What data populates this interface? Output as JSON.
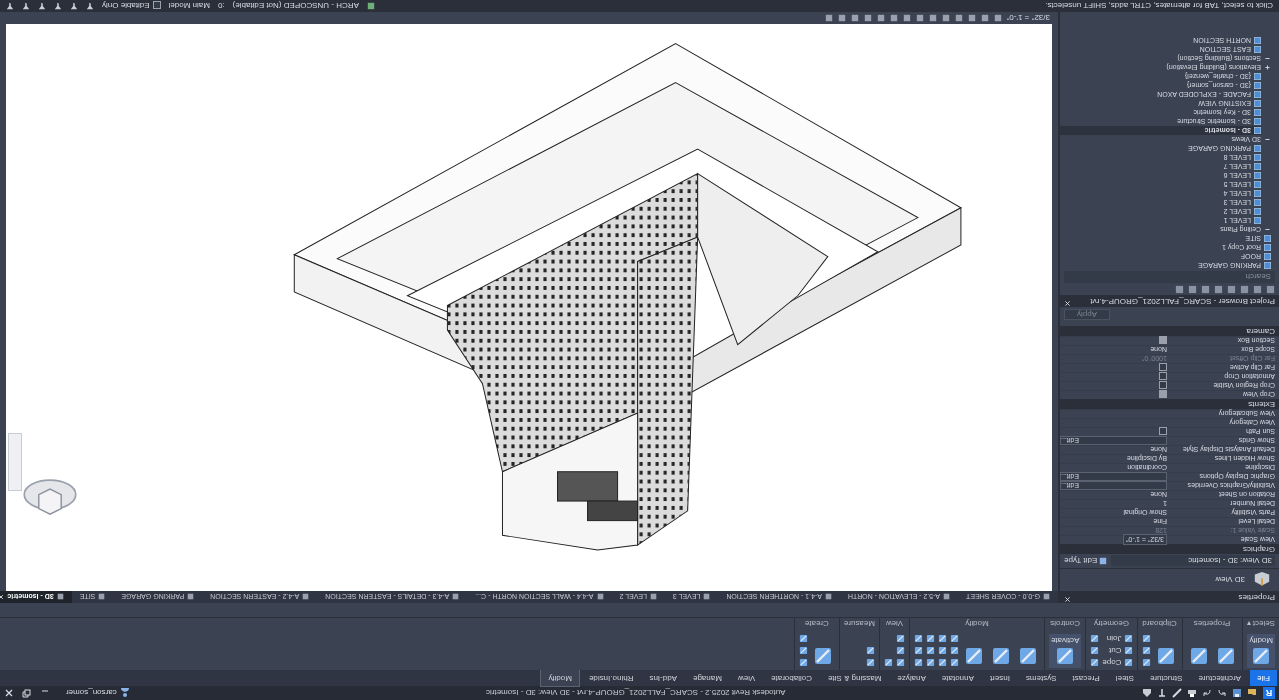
{
  "title_bar": {
    "logo": "R",
    "title": "Autodesk Revit 2025.2 - SCARC_FALL2021_GROUP-4.rvt - 3D View: 3D - Isometric",
    "user": "carson_somer"
  },
  "ribbon": {
    "tabs": [
      {
        "label": "File",
        "selected": false
      },
      {
        "label": "Architecture",
        "selected": false
      },
      {
        "label": "Structure",
        "selected": false
      },
      {
        "label": "Steel",
        "selected": false
      },
      {
        "label": "Precast",
        "selected": false
      },
      {
        "label": "Systems",
        "selected": false
      },
      {
        "label": "Insert",
        "selected": false
      },
      {
        "label": "Annotate",
        "selected": false
      },
      {
        "label": "Analyze",
        "selected": false
      },
      {
        "label": "Massing & Site",
        "selected": false
      },
      {
        "label": "Collaborate",
        "selected": false
      },
      {
        "label": "View",
        "selected": false
      },
      {
        "label": "Manage",
        "selected": false
      },
      {
        "label": "Add-Ins",
        "selected": false
      },
      {
        "label": "Rhino.Inside",
        "selected": false
      },
      {
        "label": "Modify",
        "selected": true
      }
    ],
    "panels": [
      {
        "label": "Select ▾",
        "tools": [
          {
            "kind": "large",
            "label": "Modify"
          }
        ]
      },
      {
        "label": "Properties",
        "tools": [
          {
            "kind": "large"
          },
          {
            "kind": "large"
          }
        ]
      },
      {
        "label": "Clipboard",
        "tools": [
          {
            "kind": "large"
          },
          {
            "kind": "small"
          },
          {
            "kind": "small"
          },
          {
            "kind": "small"
          }
        ]
      },
      {
        "label": "Geometry",
        "tools": [
          {
            "kind": "small",
            "label": "Cope"
          },
          {
            "kind": "small",
            "label": "Cut"
          },
          {
            "kind": "small",
            "label": "Join"
          },
          {
            "kind": "small"
          },
          {
            "kind": "small"
          },
          {
            "kind": "small"
          }
        ]
      },
      {
        "label": "Controls",
        "tools": [
          {
            "kind": "large",
            "label": "Activate"
          }
        ]
      },
      {
        "label": "Modify",
        "tools": [
          {
            "kind": "large"
          },
          {
            "kind": "large"
          },
          {
            "kind": "large"
          },
          {
            "kind": "small"
          },
          {
            "kind": "small"
          },
          {
            "kind": "small"
          },
          {
            "kind": "small"
          },
          {
            "kind": "small"
          },
          {
            "kind": "small"
          },
          {
            "kind": "small"
          },
          {
            "kind": "small"
          },
          {
            "kind": "small"
          },
          {
            "kind": "small"
          },
          {
            "kind": "small"
          },
          {
            "kind": "small"
          }
        ]
      },
      {
        "label": "View",
        "tools": [
          {
            "kind": "small"
          },
          {
            "kind": "small"
          },
          {
            "kind": "small"
          },
          {
            "kind": "small"
          }
        ]
      },
      {
        "label": "Measure",
        "tools": [
          {
            "kind": "small"
          },
          {
            "kind": "small"
          }
        ]
      },
      {
        "label": "Create",
        "tools": [
          {
            "kind": "large"
          },
          {
            "kind": "small"
          },
          {
            "kind": "small"
          },
          {
            "kind": "small"
          }
        ]
      }
    ]
  },
  "view_tabs": [
    {
      "label": "G-0.0 - COVER SHEET",
      "selected": false
    },
    {
      "label": "A-5.2 - ELEVATION - NORTH",
      "selected": false
    },
    {
      "label": "A-4.1 - NORTHERN SECTION",
      "selected": false
    },
    {
      "label": "LEVEL 3",
      "selected": false
    },
    {
      "label": "LEVEL 2",
      "selected": false
    },
    {
      "label": "A-4.4 - WALL SECTION NORTH - C...",
      "selected": false
    },
    {
      "label": "A-4.3 - DETAILS - EASTERN SECTION",
      "selected": false
    },
    {
      "label": "A-4.2 - EASTERN SECTION",
      "selected": false
    },
    {
      "label": "PARKING GARAGE",
      "selected": false
    },
    {
      "label": "SITE",
      "selected": false
    },
    {
      "label": "3D - Isometric",
      "selected": true
    }
  ],
  "properties": {
    "title": "Properties",
    "type_name": "3D View",
    "instance": "3D View: 3D - Isometric",
    "edit_type": "Edit Type",
    "groups": [
      {
        "label": "Graphics",
        "rows": [
          {
            "kind": "dropdown",
            "label": "View Scale",
            "value": "3/32\" = 1'-0\"",
            "disabled": false
          },
          {
            "kind": "text",
            "label": "Scale Value 1:",
            "value": "128",
            "disabled": true
          },
          {
            "kind": "text",
            "label": "Detail Level",
            "value": "Fine",
            "disabled": false
          },
          {
            "kind": "text",
            "label": "Parts Visibility",
            "value": "Show Original",
            "disabled": false
          },
          {
            "kind": "text",
            "label": "Detail Number",
            "value": "1",
            "disabled": false
          },
          {
            "kind": "text",
            "label": "Rotation on Sheet",
            "value": "None",
            "disabled": false
          },
          {
            "kind": "button",
            "label": "Visibility/Graphics Overrides",
            "value": "Edit...",
            "disabled": false
          },
          {
            "kind": "button",
            "label": "Graphic Display Options",
            "value": "Edit...",
            "disabled": false
          },
          {
            "kind": "text",
            "label": "Discipline",
            "value": "Coordination",
            "disabled": false
          },
          {
            "kind": "text",
            "label": "Show Hidden Lines",
            "value": "By Discipline",
            "disabled": false
          },
          {
            "kind": "text",
            "label": "Default Analysis Display Style",
            "value": "None",
            "disabled": false
          },
          {
            "kind": "button",
            "label": "Show Grids",
            "value": "Edit...",
            "disabled": false
          },
          {
            "kind": "check",
            "label": "Sun Path",
            "checked": false,
            "disabled": false
          },
          {
            "kind": "text",
            "label": "View Category",
            "disabled": false
          },
          {
            "kind": "text",
            "label": "View Subcategory",
            "disabled": false
          }
        ]
      },
      {
        "label": "Extents",
        "rows": [
          {
            "kind": "check",
            "label": "Crop View",
            "checked": true,
            "disabled": false
          },
          {
            "kind": "check",
            "label": "Crop Region Visible",
            "checked": false,
            "disabled": false
          },
          {
            "kind": "check",
            "label": "Annotation Crop",
            "checked": false,
            "disabled": false
          },
          {
            "kind": "check",
            "label": "Far Clip Active",
            "checked": false,
            "disabled": false
          },
          {
            "kind": "text",
            "label": "Far Clip Offset",
            "value": "1000' 0\"",
            "disabled": true
          },
          {
            "kind": "text",
            "label": "Scope Box",
            "value": "None",
            "disabled": false
          },
          {
            "kind": "check",
            "label": "Section Box",
            "checked": true,
            "disabled": false
          }
        ]
      },
      {
        "label": "Camera"
      }
    ],
    "apply": "Apply"
  },
  "project_browser": {
    "title": "Project Browser - SCARC_FALL2021_GROUP-4.rvt",
    "search_placeholder": "Search",
    "tree": [
      {
        "kind": "view",
        "label": "PARKING GARAGE",
        "selected": false
      },
      {
        "kind": "view",
        "label": "ROOF",
        "selected": false
      },
      {
        "kind": "view",
        "label": "Roof Copy 1",
        "selected": false
      },
      {
        "kind": "view",
        "label": "SITE",
        "selected": false
      },
      {
        "kind": "group",
        "label": "Ceiling Plans",
        "expanded": true,
        "children": [
          {
            "kind": "view",
            "label": "LEVEL 1",
            "selected": false
          },
          {
            "kind": "view",
            "label": "LEVEL 2",
            "selected": false
          },
          {
            "kind": "view",
            "label": "LEVEL 3",
            "selected": false
          },
          {
            "kind": "view",
            "label": "LEVEL 4",
            "selected": false
          },
          {
            "kind": "view",
            "label": "LEVEL 5",
            "selected": false
          },
          {
            "kind": "view",
            "label": "LEVEL 6",
            "selected": false
          },
          {
            "kind": "view",
            "label": "LEVEL 7",
            "selected": false
          },
          {
            "kind": "view",
            "label": "LEVEL 8",
            "selected": false
          },
          {
            "kind": "view",
            "label": "PARKING GARAGE",
            "selected": false
          }
        ]
      },
      {
        "kind": "group",
        "label": "3D Views",
        "expanded": true,
        "children": [
          {
            "kind": "view",
            "label": "3D - Isometric",
            "selected": true
          },
          {
            "kind": "view",
            "label": "3D - Isometric Structure",
            "selected": false
          },
          {
            "kind": "view",
            "label": "3D - Key Isometric",
            "selected": false
          },
          {
            "kind": "view",
            "label": "EXISTING VIEW",
            "selected": false
          },
          {
            "kind": "view",
            "label": "FACADE - EXPLODED AXON",
            "selected": false
          },
          {
            "kind": "view",
            "label": "{3D - carson_somer}",
            "selected": false
          },
          {
            "kind": "view",
            "label": "{3D - charlie_wenzel}",
            "selected": false
          }
        ]
      },
      {
        "kind": "group",
        "label": "Elevations (Building Elevation)",
        "expanded": false
      },
      {
        "kind": "group",
        "label": "Sections (Building Section)",
        "expanded": true,
        "children": [
          {
            "kind": "view",
            "label": "EAST SECTION",
            "selected": false
          },
          {
            "kind": "view",
            "label": "NORTH SECTION",
            "selected": false
          }
        ]
      }
    ]
  },
  "view_control": {
    "scale": "3/32\" = 1'-0\""
  },
  "status_bar": {
    "hint": "Click to select, TAB for alternates, CTRL adds, SHIFT unselects.",
    "workset": "ARCH - UNSCOPED (Not Editable)",
    "count": ":0",
    "model": "Main Model",
    "editable_only": {
      "label": "Editable Only",
      "checked": false
    }
  }
}
